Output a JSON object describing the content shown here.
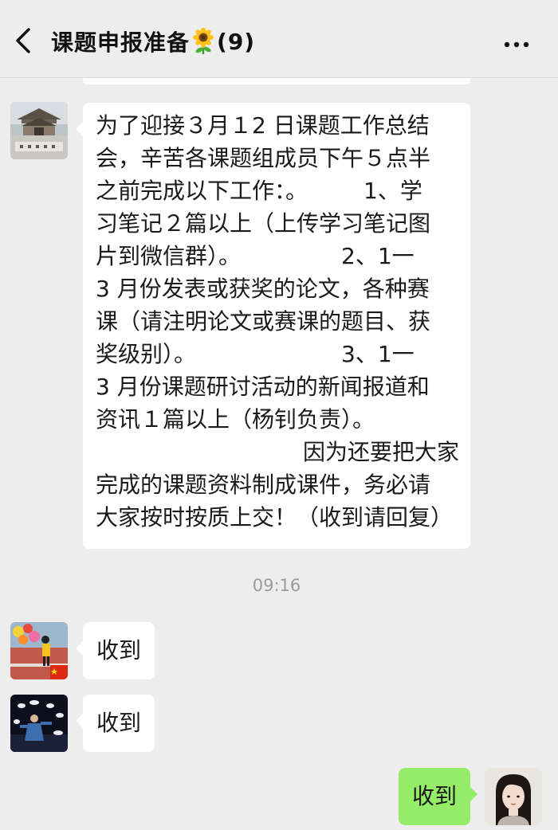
{
  "header": {
    "title": "课题申报准备",
    "title_emoji": "sunflower",
    "member_count": "(9)",
    "back_icon": "chevron-left-icon",
    "more_icon": "more-dots-icon"
  },
  "messages": {
    "announcement": {
      "sender_avatar": "pavilion-landscape",
      "lines": [
        "为了迎接３月１2 日课题工作总结",
        "会，辛苦各课题组成员下午５点半",
        "之前完成以下工作：。　　　1、学",
        "习笔记２篇以上（上传学习笔记图",
        "片到微信群）。　　　　　2、1一",
        "3 月份发表或获奖的论文，各种赛",
        "课（请注明论文或赛课的题目、获",
        "奖级别）。　　　　　　　3、1一",
        "3 月份课题研讨活动的新闻报道和",
        "资讯１篇以上（杨钊负责）。",
        "因为还要把大家",
        "完成的课题资料制成课件，务必请",
        "大家按时按质上交！（收到请回复）"
      ]
    },
    "timestamp": "09:16",
    "reply_1": {
      "sender_avatar": "balloons-child-photo",
      "text": "收到"
    },
    "reply_2": {
      "sender_avatar": "dark-dance-photo",
      "text": "收到"
    },
    "my_reply": {
      "sender_avatar": "girl-portrait",
      "text": "收到"
    }
  },
  "colors": {
    "background": "#ededed",
    "bubble_incoming": "#ffffff",
    "bubble_outgoing": "#95ec69",
    "timestamp_text": "#9b9b9b"
  }
}
